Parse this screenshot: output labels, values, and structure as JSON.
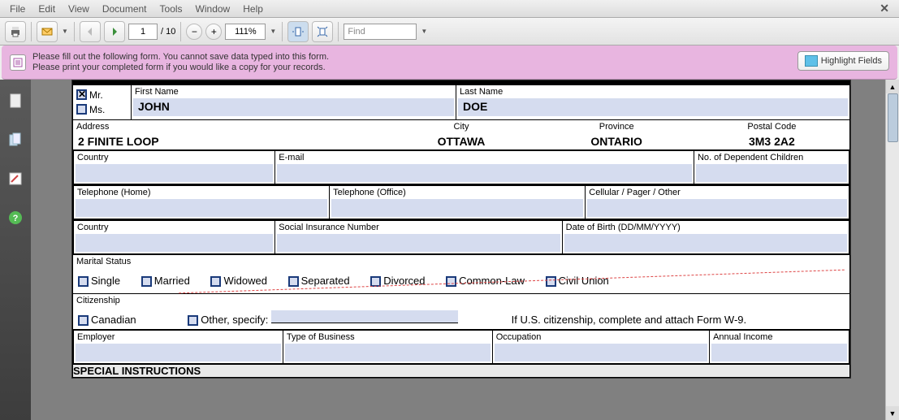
{
  "menu": {
    "file": "File",
    "edit": "Edit",
    "view": "View",
    "document": "Document",
    "tools": "Tools",
    "window": "Window",
    "help": "Help"
  },
  "toolbar": {
    "page": "1",
    "total": "/ 10",
    "zoom": "111%",
    "find": "Find"
  },
  "info": {
    "line1": "Please fill out the following form. You cannot save data typed into this form.",
    "line2": "Please print your completed form if you would like a copy for your records.",
    "highlight": "Highlight Fields"
  },
  "form": {
    "title": {
      "mr": "Mr.",
      "ms": "Ms."
    },
    "labels": {
      "firstName": "First Name",
      "lastName": "Last Name",
      "address": "Address",
      "city": "City",
      "province": "Province",
      "postal": "Postal Code",
      "country": "Country",
      "email": "E-mail",
      "depChildren": "No. of Dependent Children",
      "telHome": "Telephone (Home)",
      "telOffice": "Telephone (Office)",
      "cell": "Cellular / Pager / Other",
      "sin": "Social Insurance Number",
      "dob": "Date of Birth (DD/MM/YYYY)",
      "marital": "Marital Status",
      "citizenship": "Citizenship",
      "employer": "Employer",
      "bizType": "Type of Business",
      "occupation": "Occupation",
      "income": "Annual Income",
      "special": "SPECIAL INSTRUCTIONS"
    },
    "values": {
      "firstName": "JOHN",
      "lastName": "DOE",
      "address": "2 FINITE LOOP",
      "city": "OTTAWA",
      "province": "ONTARIO",
      "postal": "3M3 2A2"
    },
    "marital": {
      "single": "Single",
      "married": "Married",
      "widowed": "Widowed",
      "separated": "Separated",
      "divorced": "Divorced",
      "common": "Common-Law",
      "civil": "Civil Union"
    },
    "citizenship": {
      "canadian": "Canadian",
      "other": "Other, specify:",
      "usNote": "If U.S. citizenship, complete and attach Form W-9."
    }
  }
}
